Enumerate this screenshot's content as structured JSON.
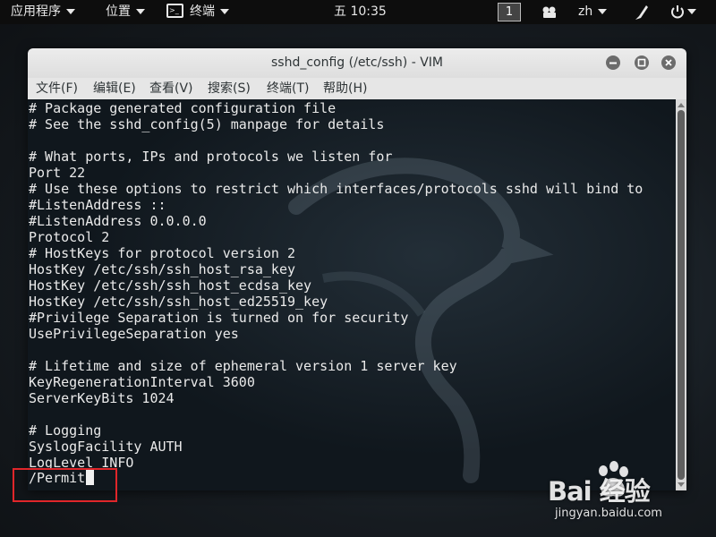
{
  "topbar": {
    "applications_label": "应用程序",
    "places_label": "位置",
    "terminal_label": "终端",
    "clock": "五 10:35",
    "workspace_number": "1",
    "input_method": "zh"
  },
  "window": {
    "title": "sshd_config (/etc/ssh) - VIM",
    "menu": [
      "文件(F)",
      "编辑(E)",
      "查看(V)",
      "搜索(S)",
      "终端(T)",
      "帮助(H)"
    ]
  },
  "terminal": {
    "lines": [
      "# Package generated configuration file",
      "# See the sshd_config(5) manpage for details",
      "",
      "# What ports, IPs and protocols we listen for",
      "Port 22",
      "# Use these options to restrict which interfaces/protocols sshd will bind to",
      "#ListenAddress ::",
      "#ListenAddress 0.0.0.0",
      "Protocol 2",
      "# HostKeys for protocol version 2",
      "HostKey /etc/ssh/ssh_host_rsa_key",
      "HostKey /etc/ssh/ssh_host_ecdsa_key",
      "HostKey /etc/ssh/ssh_host_ed25519_key",
      "#Privilege Separation is turned on for security",
      "UsePrivilegeSeparation yes",
      "",
      "# Lifetime and size of ephemeral version 1 server key",
      "KeyRegenerationInterval 3600",
      "ServerKeyBits 1024",
      "",
      "# Logging",
      "SyslogFacility AUTH",
      "LogLevel INFO"
    ],
    "command_line": "/Permit"
  },
  "watermark": {
    "logo_text": "Bai  经验",
    "url": "jingyan.baidu.com"
  },
  "colors": {
    "highlight": "#e0262a",
    "terminal_bg": "#10171d",
    "terminal_fg": "#eaeaea"
  },
  "icons": [
    "terminal-icon",
    "camera-icon",
    "pen-icon",
    "power-icon",
    "minimize-icon",
    "maximize-icon",
    "close-icon"
  ]
}
